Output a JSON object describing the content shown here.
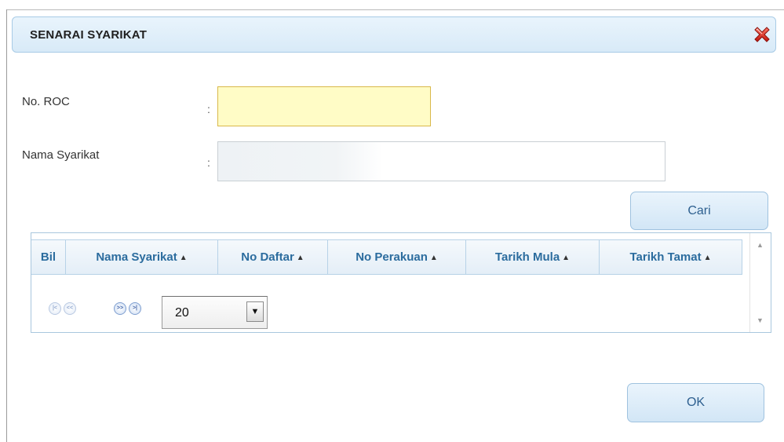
{
  "dialog": {
    "title": "SENARAI SYARIKAT",
    "close_icon": "close-x-icon"
  },
  "form": {
    "roc_label": "No. ROC",
    "roc_colon": ":",
    "roc_value": "",
    "nama_label": "Nama Syarikat",
    "nama_colon": ":",
    "nama_value": ""
  },
  "buttons": {
    "search_label": "Cari",
    "ok_label": "OK"
  },
  "grid": {
    "columns": [
      {
        "label": "Bil",
        "sortable": false
      },
      {
        "label": "Nama Syarikat",
        "sortable": true
      },
      {
        "label": "No Daftar",
        "sortable": true
      },
      {
        "label": "No Perakuan",
        "sortable": true
      },
      {
        "label": "Tarikh Mula",
        "sortable": true
      },
      {
        "label": "Tarikh Tamat",
        "sortable": true
      }
    ],
    "sort_glyph": "▲▼",
    "rows": []
  },
  "pager": {
    "page_size": "20",
    "buttons": [
      "first-page-icon",
      "prev-page-icon",
      "next-page-icon",
      "last-page-icon"
    ]
  },
  "colors": {
    "header_text": "#2b6c9e",
    "button_text": "#2d5f8f",
    "roc_field_bg": "#fffcc6"
  }
}
